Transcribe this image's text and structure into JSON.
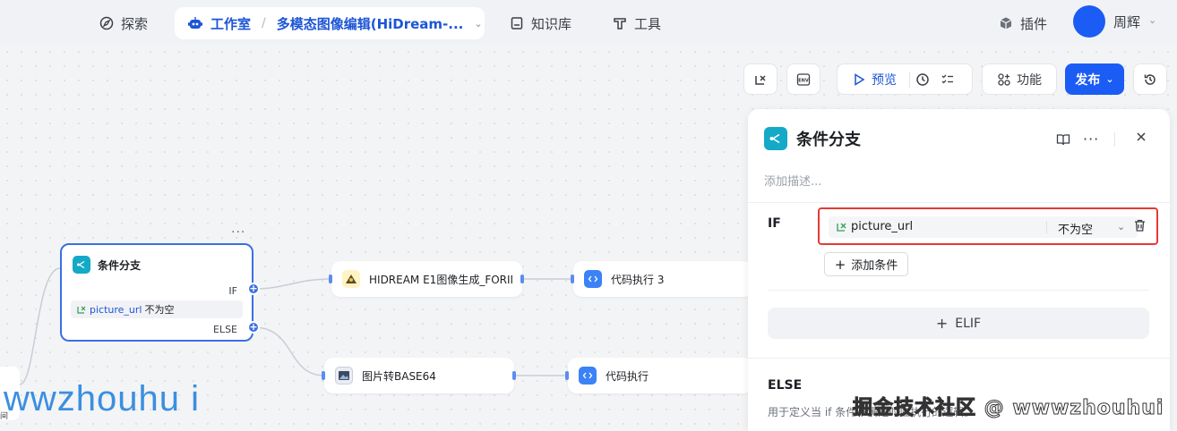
{
  "nav": {
    "explore": "探索",
    "studio_label": "工作室",
    "studio_name": "多模态图像编辑(HiDream-...",
    "knowledge": "知识库",
    "tools": "工具",
    "plugins": "插件",
    "user_name": "周辉"
  },
  "toolbar": {
    "preview": "预览",
    "features": "功能",
    "publish": "发布"
  },
  "canvas": {
    "branch_node": {
      "title": "条件分支",
      "if_label": "IF",
      "else_label": "ELSE",
      "condition_var": "picture_url",
      "condition_op": "不为空"
    },
    "nodes": [
      {
        "title": "HIDREAM E1图像生成_FORIM"
      },
      {
        "title": "代码执行 3"
      },
      {
        "title": "图片转BASE64"
      },
      {
        "title": "代码执行"
      }
    ],
    "stub_text": "间"
  },
  "panel": {
    "title": "条件分支",
    "description_placeholder": "添加描述...",
    "if_label": "IF",
    "condition_var": "picture_url",
    "condition_op": "不为空",
    "add_condition": "添加条件",
    "elif": "ELIF",
    "else_label": "ELSE",
    "else_desc": "用于定义当 if 条件不满足时应执行的逻辑。"
  },
  "watermarks": {
    "right": "掘金技术社区 @ wwwzhouhui",
    "left": "wwzhouhu i"
  },
  "colors": {
    "accent": "#1b5cf5",
    "highlight_border": "#e53935",
    "branch_icon": "#14a9c7",
    "code_icon": "#3b82f6"
  }
}
